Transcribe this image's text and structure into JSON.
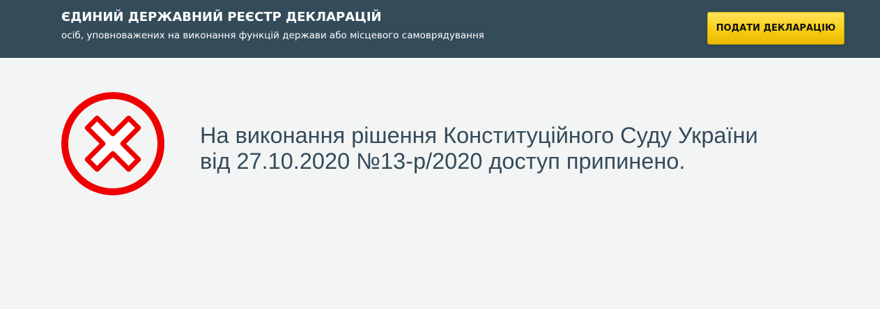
{
  "header": {
    "title": "ЄДИНИЙ ДЕРЖАВНИЙ РЕЄСТР ДЕКЛАРАЦІЙ",
    "subtitle": "осіб, уповноважених на виконання функцій держави або місцевого самоврядування",
    "submit_button_label": "ПОДАТИ ДЕКЛАРАЦІЮ"
  },
  "main": {
    "icon": "error-x-circle-icon",
    "message_line1": "На виконання рішення Конституційного Суду України",
    "message_line2": "від 27.10.2020 №13-р/2020 доступ припинено."
  },
  "colors": {
    "header_background": "#344b5a",
    "page_background": "#f3f4f4",
    "button_yellow": "#f7cf13",
    "error_red": "#ee0000",
    "message_text": "#344b5a"
  }
}
